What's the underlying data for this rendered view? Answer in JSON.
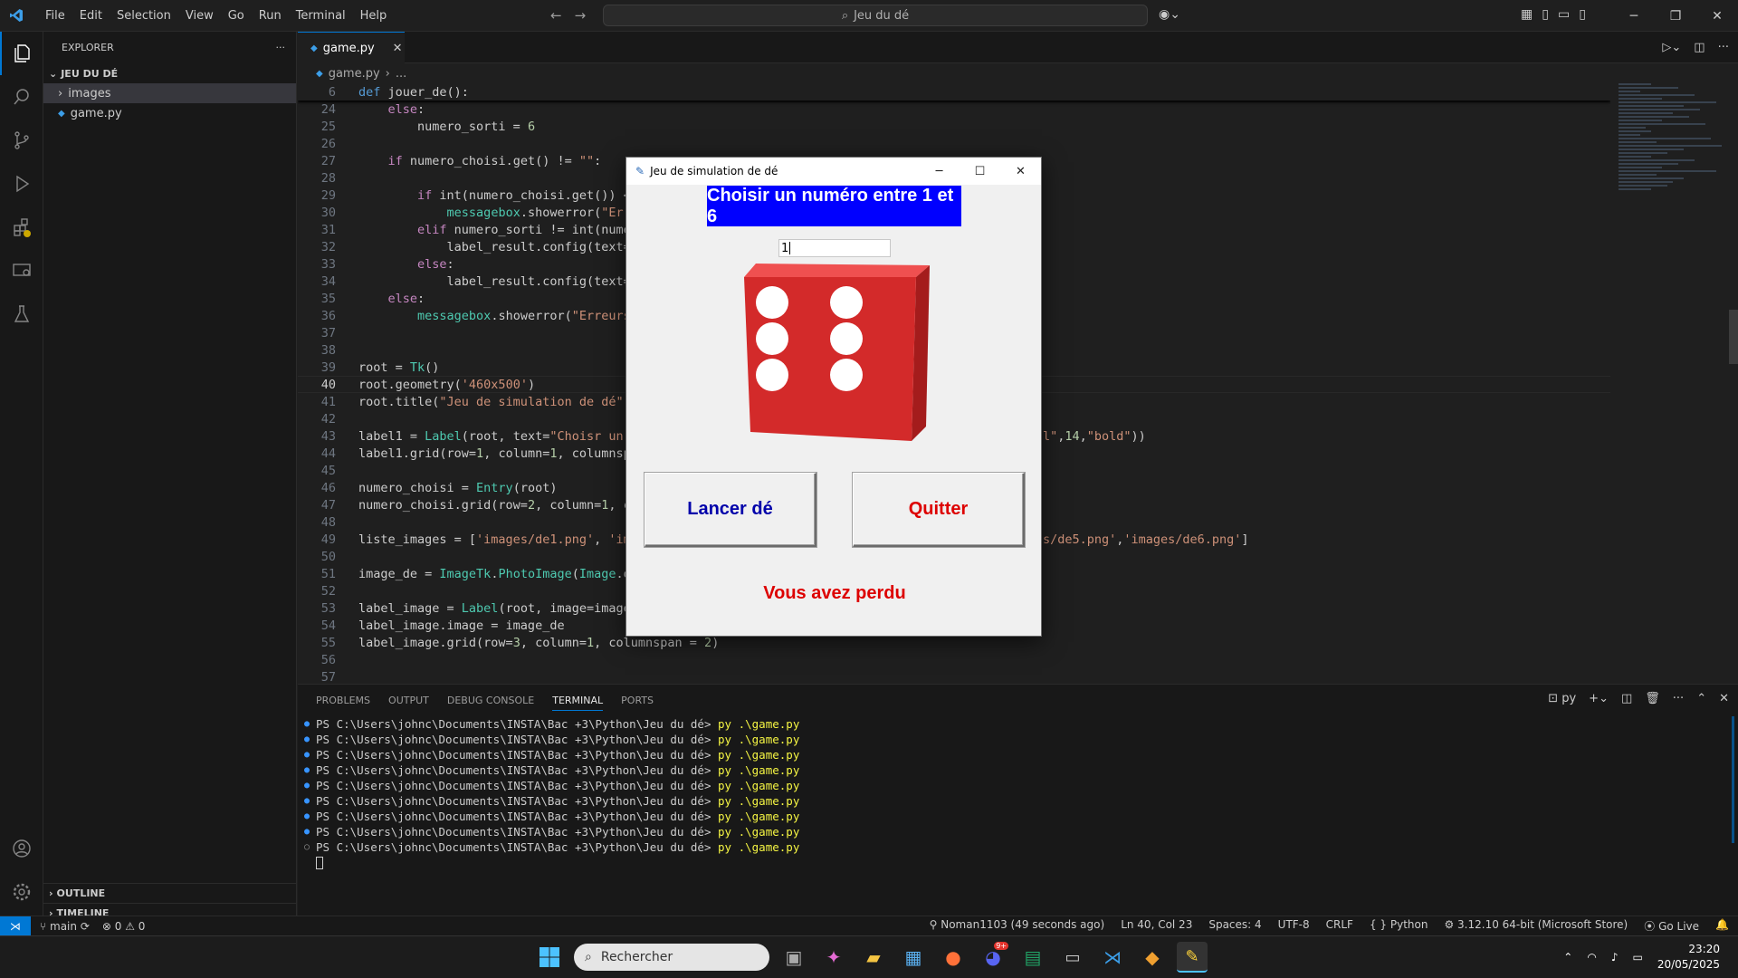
{
  "menu": [
    "File",
    "Edit",
    "Selection",
    "View",
    "Go",
    "Run",
    "Terminal",
    "Help"
  ],
  "search_text": "Jeu du dé",
  "sidebar": {
    "title": "EXPLORER",
    "folder": "JEU DU DÉ",
    "items": [
      {
        "label": "images",
        "type": "folder"
      },
      {
        "label": "game.py",
        "type": "file"
      }
    ],
    "outline": "OUTLINE",
    "timeline": "TIMELINE"
  },
  "tab": {
    "label": "game.py"
  },
  "breadcrumb": {
    "file": "game.py",
    "rest": "..."
  },
  "code_lines": [
    {
      "n": "6",
      "t": "def jouer_de():",
      "sticky": true
    },
    {
      "n": "24",
      "t": "    else:"
    },
    {
      "n": "25",
      "t": "        numero_sorti = 6"
    },
    {
      "n": "26",
      "t": ""
    },
    {
      "n": "27",
      "t": "    if numero_choisi.get() != \"\":"
    },
    {
      "n": "28",
      "t": ""
    },
    {
      "n": "29",
      "t": "        if int(numero_choisi.get()) <1 or int(numero_choisi.get()) >6:"
    },
    {
      "n": "30",
      "t": "            messagebox.showerror(\"Erreurs\", \"Vous devez choisir un numéro entre 1 et 6\")"
    },
    {
      "n": "31",
      "t": "        elif numero_sorti != int(numero_choisi.get()):"
    },
    {
      "n": "32",
      "t": "            label_result.config(text=\"Vous avez perdu\")"
    },
    {
      "n": "33",
      "t": "        else:"
    },
    {
      "n": "34",
      "t": "            label_result.config(text=\"Vous avez gagné\")"
    },
    {
      "n": "35",
      "t": "    else:"
    },
    {
      "n": "36",
      "t": "        messagebox.showerror(\"Erreurs\", \"Vous devez choisir un numéro\")"
    },
    {
      "n": "37",
      "t": ""
    },
    {
      "n": "38",
      "t": ""
    },
    {
      "n": "39",
      "t": "root = Tk()"
    },
    {
      "n": "40",
      "t": "root.geometry('460x500')",
      "current": true
    },
    {
      "n": "41",
      "t": "root.title(\"Jeu de simulation de dé\")"
    },
    {
      "n": "42",
      "t": ""
    },
    {
      "n": "43",
      "t": "label1 = Label(root, text=\"Choisr un numéro entre 1 et 6\", bg=\"blue\", fg=\"white\", font=(\"Arial\",14,\"bold\"))"
    },
    {
      "n": "44",
      "t": "label1.grid(row=1, column=1, columnspan = 2, pady = 10)"
    },
    {
      "n": "45",
      "t": ""
    },
    {
      "n": "46",
      "t": "numero_choisi = Entry(root)"
    },
    {
      "n": "47",
      "t": "numero_choisi.grid(row=2, column=1, columnspan = 2)"
    },
    {
      "n": "48",
      "t": ""
    },
    {
      "n": "49",
      "t": "liste_images = ['images/de1.png', 'images/de2.png', 'images/de3.png', 'images/de4.png','images/de5.png','images/de6.png']"
    },
    {
      "n": "50",
      "t": ""
    },
    {
      "n": "51",
      "t": "image_de = ImageTk.PhotoImage(Image.open(\"images/de6.png\"))"
    },
    {
      "n": "52",
      "t": ""
    },
    {
      "n": "53",
      "t": "label_image = Label(root, image=image_de)"
    },
    {
      "n": "54",
      "t": "label_image.image = image_de"
    },
    {
      "n": "55",
      "t": "label_image.grid(row=3, column=1, columnspan = 2)"
    },
    {
      "n": "56",
      "t": ""
    },
    {
      "n": "57",
      "t": ""
    }
  ],
  "panel": {
    "tabs": [
      "PROBLEMS",
      "OUTPUT",
      "DEBUG CONSOLE",
      "TERMINAL",
      "PORTS"
    ],
    "active_tab": "TERMINAL",
    "shell": "py",
    "prompt": "PS C:\\Users\\johnc\\Documents\\INSTA\\Bac +3\\Python\\Jeu du dé>",
    "command": "py .\\game.py",
    "lines": 9
  },
  "statusbar": {
    "branch": "main",
    "errors": "0",
    "warnings": "0",
    "blame": "Noman1103 (49 seconds ago)",
    "position": "Ln 40, Col 23",
    "spaces": "Spaces: 4",
    "encoding": "UTF-8",
    "eol": "CRLF",
    "language": "Python",
    "interpreter": "3.12.10 64-bit (Microsoft Store)",
    "golive": "Go Live"
  },
  "taskbar": {
    "search_placeholder": "Rechercher",
    "time": "23:20",
    "date": "20/05/2025",
    "discord_badge": "9+"
  },
  "tk_window": {
    "title": "Jeu de simulation de dé",
    "label": "Choisir un numéro entre 1 et 6",
    "entry_value": "1",
    "button_roll": "Lancer dé",
    "button_quit": "Quitter",
    "result": "Vous avez perdu",
    "die_face": 6
  },
  "colors": {
    "accent": "#0078d4",
    "tk_label_bg": "#0000ff",
    "tk_roll_text": "#0000aa",
    "tk_red": "#dd0000",
    "die_red": "#d32a2a"
  }
}
